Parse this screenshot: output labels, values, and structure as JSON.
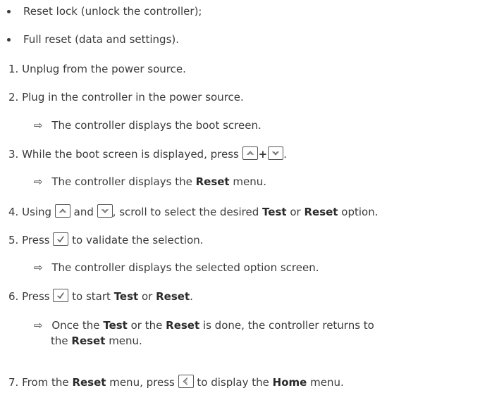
{
  "bullets": [
    "Reset lock (unlock the controller);",
    "Full reset (data and settings)."
  ],
  "steps": {
    "s1": {
      "num": "1.",
      "text": "Unplug from the power source."
    },
    "s2": {
      "num": "2.",
      "text": "Plug in the controller in the power source."
    },
    "r2": "The controller displays the boot screen.",
    "s3": {
      "num": "3.",
      "pre": "While the boot screen is displayed, press",
      "plus": "+",
      "post": "."
    },
    "r3": {
      "pre": "The controller displays the",
      "bold": "Reset",
      "post": "menu."
    },
    "s4": {
      "num": "4.",
      "a": "Using",
      "b": "and",
      "c": ", scroll to select the desired",
      "bold1": "Test",
      "d": "or",
      "bold2": "Reset",
      "e": "option."
    },
    "s5": {
      "num": "5.",
      "a": "Press",
      "b": "to validate the selection."
    },
    "r5": "The controller displays the selected option screen.",
    "s6": {
      "num": "6.",
      "a": "Press",
      "b": "to start",
      "bold1": "Test",
      "c": "or",
      "bold2": "Reset",
      "d": "."
    },
    "r6": {
      "a": "Once the",
      "bold1": "Test",
      "b": "or the",
      "bold2": "Reset",
      "c": "is done, the controller returns to",
      "d": "the",
      "bold3": "Reset",
      "e": "menu."
    },
    "s7": {
      "num": "7.",
      "a": "From the",
      "bold1": "Reset",
      "b": "menu, press",
      "c": "to display the",
      "bold2": "Home",
      "d": "menu."
    }
  },
  "result_arrow": "⇨",
  "icons": [
    "up-key-icon",
    "down-key-icon",
    "check-key-icon",
    "back-key-icon"
  ]
}
